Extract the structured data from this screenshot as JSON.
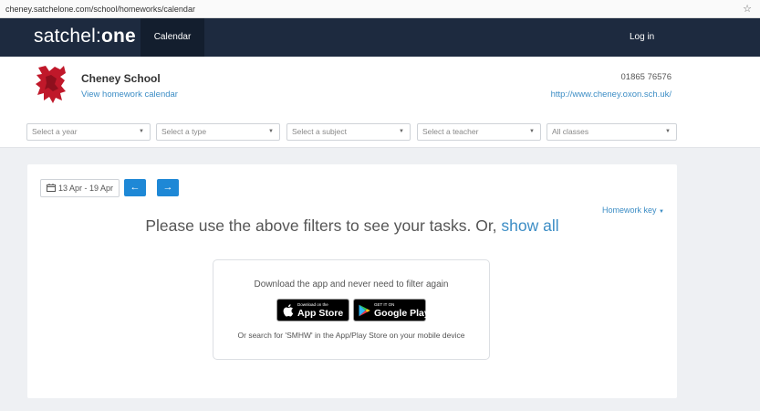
{
  "browser": {
    "url": "cheney.satchelone.com/school/homeworks/calendar"
  },
  "nav": {
    "logo_regular": "satchel:",
    "logo_bold": "one",
    "calendar": "Calendar",
    "login": "Log in"
  },
  "school": {
    "name": "Cheney School",
    "link": "View homework calendar",
    "phone": "01865 76576",
    "website": "http://www.cheney.oxon.sch.uk/"
  },
  "filters": {
    "year": "Select a year",
    "type": "Select a type",
    "subject": "Select a subject",
    "teacher": "Select a teacher",
    "classes": "All classes"
  },
  "calendar": {
    "date_range": "13 Apr - 19 Apr",
    "homework_key": "Homework key",
    "message": "Please use the above filters to see your tasks. Or, ",
    "show_all": "show all"
  },
  "apps": {
    "title": "Download the app and never need to filter again",
    "appstore_small": "Download on the",
    "appstore_big": "App Store",
    "play_small": "GET IT ON",
    "play_big": "Google Play",
    "footer": "Or search for 'SMHW' in the App/Play Store on your mobile device"
  },
  "colors": {
    "nav_bg": "#1d2a3f",
    "accent": "#1e88d6",
    "link": "#3c8dc5"
  }
}
